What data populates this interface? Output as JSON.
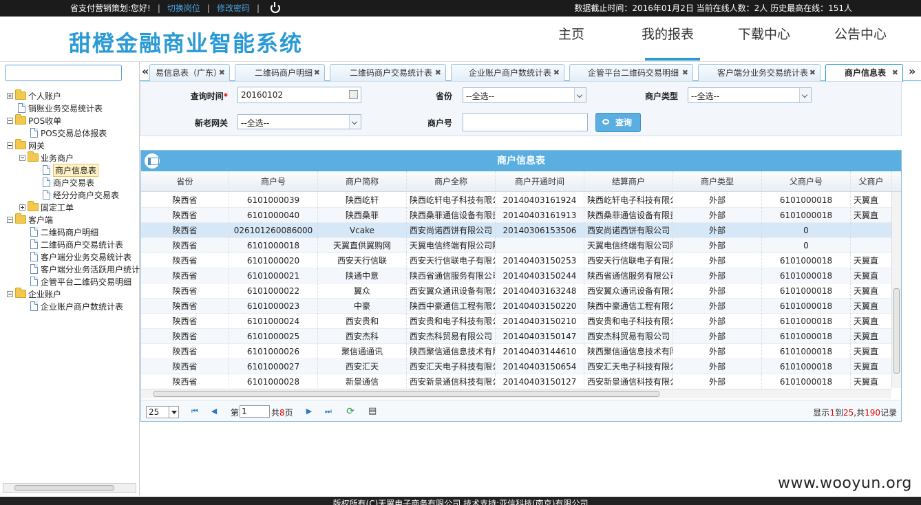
{
  "topbar": {
    "greeting": "省支付营销策划:您好!",
    "switch_role": "切换岗位",
    "change_password": "修改密码",
    "status": "数据截止时间：2016年01月2日 当前在线人数：2人 历史最高在线：151人"
  },
  "header": {
    "logo": "甜橙金融商业智能系统",
    "nav": [
      "主页",
      "我的报表",
      "下载中心",
      "公告中心"
    ]
  },
  "sidebar": {
    "tree": [
      {
        "label": "个人账户",
        "type": "folder",
        "toggle": "plus"
      },
      {
        "label": "销账业务交易统计表",
        "type": "file"
      },
      {
        "label": "POS收单",
        "type": "folder",
        "toggle": "minus"
      },
      {
        "label": "POS交易总体报表",
        "type": "file"
      },
      {
        "label": "网关",
        "type": "folder",
        "toggle": "minus"
      },
      {
        "label": "业务商户",
        "type": "folder",
        "toggle": "minus"
      },
      {
        "label": "商户信息表",
        "type": "file"
      },
      {
        "label": "商户交易表",
        "type": "file"
      },
      {
        "label": "经分分商户交易表",
        "type": "file"
      },
      {
        "label": "固定工单",
        "type": "folder",
        "toggle": "plus"
      },
      {
        "label": "客户端",
        "type": "folder",
        "toggle": "minus"
      },
      {
        "label": "二维码商户明细",
        "type": "file"
      },
      {
        "label": "二维码商户交易统计表",
        "type": "file"
      },
      {
        "label": "客户端分业务交易统计表",
        "type": "file"
      },
      {
        "label": "客户端分业务活跃用户统计",
        "type": "file"
      },
      {
        "label": "企管平台二维码交易明细",
        "type": "file"
      },
      {
        "label": "企业账户",
        "type": "folder",
        "toggle": "minus"
      },
      {
        "label": "企业账户商户数统计表",
        "type": "file"
      }
    ]
  },
  "tabs": [
    "易信息表（广东）",
    "二维码商户明细",
    "二维码商户交易统计表",
    "企业账户商户数统计表",
    "企管平台二维码交易明细",
    "客户端分业务交易统计表",
    "商户信息表"
  ],
  "query": {
    "time_label": "查询时间",
    "time_required": "*",
    "time_value": "20160102",
    "province_label": "省份",
    "province_value": "--全选--",
    "merchant_type_label": "商户类型",
    "merchant_type_value": "--全选--",
    "gateway_label": "新老网关",
    "gateway_value": "--全选--",
    "merchant_no_label": "商户号",
    "merchant_no_value": "",
    "search_button": "查询"
  },
  "grid": {
    "title": "商户信息表",
    "columns": [
      "省份",
      "商户号",
      "商户简称",
      "商户全称",
      "商户开通时间",
      "结算商户",
      "商户类型",
      "父商户号",
      "父商户"
    ],
    "rows": [
      [
        "陕西省",
        "6101000039",
        "陕西屹轩",
        "陕西屹轩电子科技有限公",
        "20140403161924",
        "陕西屹轩电子科技有限公",
        "外部",
        "6101000018",
        "天翼直"
      ],
      [
        "陕西省",
        "6101000040",
        "陕西桑菲",
        "陕西桑菲通信设备有限责",
        "20140403161913",
        "陕西桑菲通信设备有限责",
        "外部",
        "6101000018",
        "天翼直"
      ],
      [
        "陕西省",
        "026101260086000",
        "Vcake",
        "西安尚诺西饼有限公司",
        "20140306153506",
        "西安尚诺西饼有限公司",
        "外部",
        "0",
        ""
      ],
      [
        "陕西省",
        "6101000018",
        "天翼直供翼购网",
        "天翼电信终端有限公司陕",
        "",
        "天翼电信终端有限公司陕",
        "外部",
        "0",
        ""
      ],
      [
        "陕西省",
        "6101000020",
        "西安天行信联",
        "西安天行信联电子有限公",
        "20140403150253",
        "西安天行信联电子有限公",
        "外部",
        "6101000018",
        "天翼直"
      ],
      [
        "陕西省",
        "6101000021",
        "陕通中意",
        "陕西省通信服务有限公司",
        "20140403150244",
        "陕西省通信服务有限公司",
        "外部",
        "6101000018",
        "天翼直"
      ],
      [
        "陕西省",
        "6101000022",
        "翼众",
        "西安翼众通讯设备有限公",
        "20140403163248",
        "西安翼众通讯设备有限公",
        "外部",
        "6101000018",
        "天翼直"
      ],
      [
        "陕西省",
        "6101000023",
        "中豪",
        "陕西中豪通信工程有限公",
        "20140403150220",
        "陕西中豪通信工程有限公",
        "外部",
        "6101000018",
        "天翼直"
      ],
      [
        "陕西省",
        "6101000024",
        "西安贵和",
        "西安贵和电子科技有限公",
        "20140403150210",
        "西安贵和电子科技有限公",
        "外部",
        "6101000018",
        "天翼直"
      ],
      [
        "陕西省",
        "6101000025",
        "西安杰科",
        "西安杰科贸易有限公司",
        "20140403150147",
        "西安杰科贸易有限公司",
        "外部",
        "6101000018",
        "天翼直"
      ],
      [
        "陕西省",
        "6101000026",
        "聚信通通讯",
        "陕西聚信通信息技术有限",
        "20140403144610",
        "陕西聚信通信息技术有限",
        "外部",
        "6101000018",
        "天翼直"
      ],
      [
        "陕西省",
        "6101000027",
        "西安汇天",
        "西安汇天电子科技有限公",
        "20140403150654",
        "西安汇天电子科技有限公",
        "外部",
        "6101000018",
        "天翼直"
      ],
      [
        "陕西省",
        "6101000028",
        "新景通信",
        "西安新景通信科技有限公",
        "20140403150127",
        "西安新景通信科技有限公",
        "外部",
        "6101000018",
        "天翼直"
      ]
    ]
  },
  "pager": {
    "page_size": "25",
    "page_prefix": "第",
    "page_value": "1",
    "total_prefix": "共",
    "total_pages": "8",
    "total_suffix": "页",
    "info_prefix": "显示",
    "info_from": "1",
    "info_to_label": "到",
    "info_to": "25",
    "info_total_label": ",共",
    "info_total": "190",
    "info_suffix": "记录"
  },
  "watermark": "www.wooyun.org",
  "footer": "版权所有(C)天翼电子商务有限公司 技术支持:亚信科技(南京)有限公司"
}
